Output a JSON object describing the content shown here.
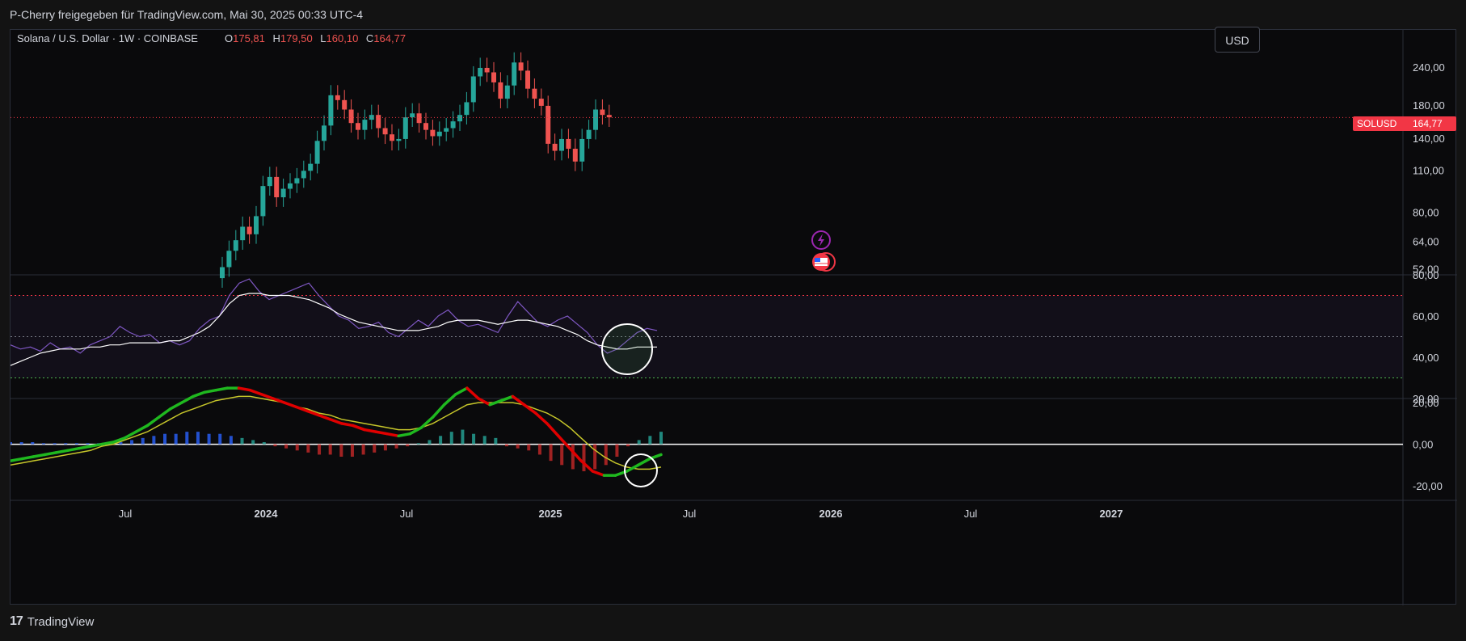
{
  "header": {
    "share_text": "P-Cherry freigegeben für TradingView.com, Mai 30, 2025 00:33 UTC-4"
  },
  "legend": {
    "symbol": "Solana / U.S. Dollar · 1W · COINBASE",
    "o_label": "O",
    "o_value": "175,81",
    "h_label": "H",
    "h_value": "179,50",
    "l_label": "L",
    "l_value": "160,10",
    "c_label": "C",
    "c_value": "164,77"
  },
  "currency_button": "USD",
  "price_tag": {
    "symbol": "SOLUSD",
    "value": "164,77"
  },
  "brand": "TradingView",
  "colors": {
    "up": "#26a69a",
    "down": "#ef5350",
    "rsi": "#7e57c2",
    "signal": "#ffffff",
    "macd_up": "#1fb81f",
    "macd_down": "#e00000"
  },
  "chart_data": [
    {
      "type": "candlestick",
      "title": "Solana / U.S. Dollar · 1W · COINBASE",
      "y_scale": "log",
      "y_ticks": [
        "240,00",
        "180,00",
        "140,00",
        "110,00",
        "80,00",
        "64,00",
        "52,00"
      ],
      "x_ticks": [
        "Jul",
        "2024",
        "Jul",
        "2025",
        "Jul",
        "2026",
        "Jul",
        "2027"
      ],
      "last_price": 164.77,
      "closes": [
        53,
        60,
        65,
        72,
        68,
        78,
        98,
        105,
        90,
        96,
        100,
        104,
        110,
        116,
        138,
        155,
        195,
        188,
        175,
        158,
        150,
        162,
        168,
        152,
        145,
        138,
        140,
        165,
        170,
        158,
        150,
        143,
        148,
        152,
        160,
        168,
        185,
        225,
        240,
        232,
        215,
        190,
        210,
        250,
        235,
        205,
        190,
        180,
        135,
        128,
        140,
        130,
        118,
        140,
        150,
        175,
        168,
        165
      ]
    },
    {
      "type": "line",
      "name": "RSI",
      "y_ticks": [
        "80,00",
        "60,00",
        "40,00",
        "20,00"
      ],
      "ylim": [
        20,
        80
      ],
      "overbought": 70,
      "mid": 50,
      "oversold": 30,
      "rsi": [
        46,
        44,
        45,
        43,
        47,
        44,
        45,
        42,
        46,
        48,
        50,
        55,
        52,
        50,
        51,
        47,
        48,
        46,
        48,
        54,
        58,
        60,
        70,
        76,
        78,
        72,
        68,
        70,
        72,
        74,
        76,
        70,
        65,
        60,
        58,
        54,
        55,
        57,
        52,
        50,
        54,
        58,
        55,
        60,
        63,
        58,
        55,
        56,
        54,
        52,
        60,
        67,
        62,
        57,
        55,
        58,
        60,
        56,
        52,
        46,
        42,
        44,
        48,
        52,
        54,
        53
      ],
      "rsi_ma": [
        36,
        38,
        40,
        42,
        43,
        44,
        44,
        44,
        45,
        45,
        46,
        46,
        47,
        47,
        47,
        47,
        48,
        48,
        50,
        52,
        55,
        60,
        66,
        70,
        71,
        71,
        70,
        70,
        70,
        69,
        68,
        66,
        64,
        61,
        59,
        57,
        56,
        55,
        54,
        53,
        53,
        53,
        54,
        55,
        57,
        58,
        58,
        58,
        57,
        56,
        57,
        58,
        58,
        57,
        56,
        55,
        53,
        51,
        48,
        46,
        45,
        44,
        44,
        45,
        45,
        45
      ]
    },
    {
      "type": "line",
      "name": "MACD",
      "y_ticks": [
        "20,00",
        "0,00",
        "-20,00"
      ],
      "ylim": [
        -27,
        22
      ],
      "macd": [
        -8,
        -7,
        -6,
        -5,
        -4,
        -3,
        -2,
        -1,
        0,
        1,
        3,
        6,
        9,
        13,
        17,
        20,
        23,
        25,
        26,
        27,
        27,
        26,
        24,
        22,
        20,
        18,
        16,
        14,
        12,
        10,
        9,
        7,
        6,
        5,
        4,
        5,
        8,
        13,
        19,
        24,
        27,
        22,
        19,
        21,
        23,
        19,
        15,
        10,
        4,
        -2,
        -8,
        -13,
        -15,
        -15,
        -13,
        -10,
        -7,
        -5
      ],
      "signal": [
        -10,
        -9,
        -8,
        -7,
        -6,
        -5,
        -4,
        -3,
        -1,
        0,
        2,
        4,
        6,
        9,
        12,
        15,
        17,
        19,
        21,
        22,
        23,
        23,
        22,
        21,
        20,
        18,
        17,
        15,
        14,
        12,
        11,
        10,
        9,
        8,
        7,
        7,
        8,
        10,
        13,
        16,
        19,
        20,
        20,
        20,
        20,
        19,
        17,
        15,
        12,
        8,
        3,
        -2,
        -6,
        -9,
        -11,
        -12,
        -12,
        -11
      ],
      "histogram": [
        1,
        1,
        1,
        0.5,
        0.5,
        0.5,
        0.5,
        0.5,
        0.5,
        1,
        1,
        2,
        3,
        4,
        5,
        5,
        6,
        6,
        5,
        5,
        4,
        3,
        2,
        1,
        -1,
        -2,
        -3,
        -4,
        -5,
        -5,
        -6,
        -6,
        -5,
        -4,
        -3,
        -2,
        -1,
        0.5,
        2,
        4,
        6,
        7,
        5,
        4,
        3,
        -1,
        -2,
        -3,
        -5,
        -8,
        -10,
        -12,
        -13,
        -12,
        -10,
        -6,
        -1,
        2,
        4,
        6
      ]
    }
  ]
}
